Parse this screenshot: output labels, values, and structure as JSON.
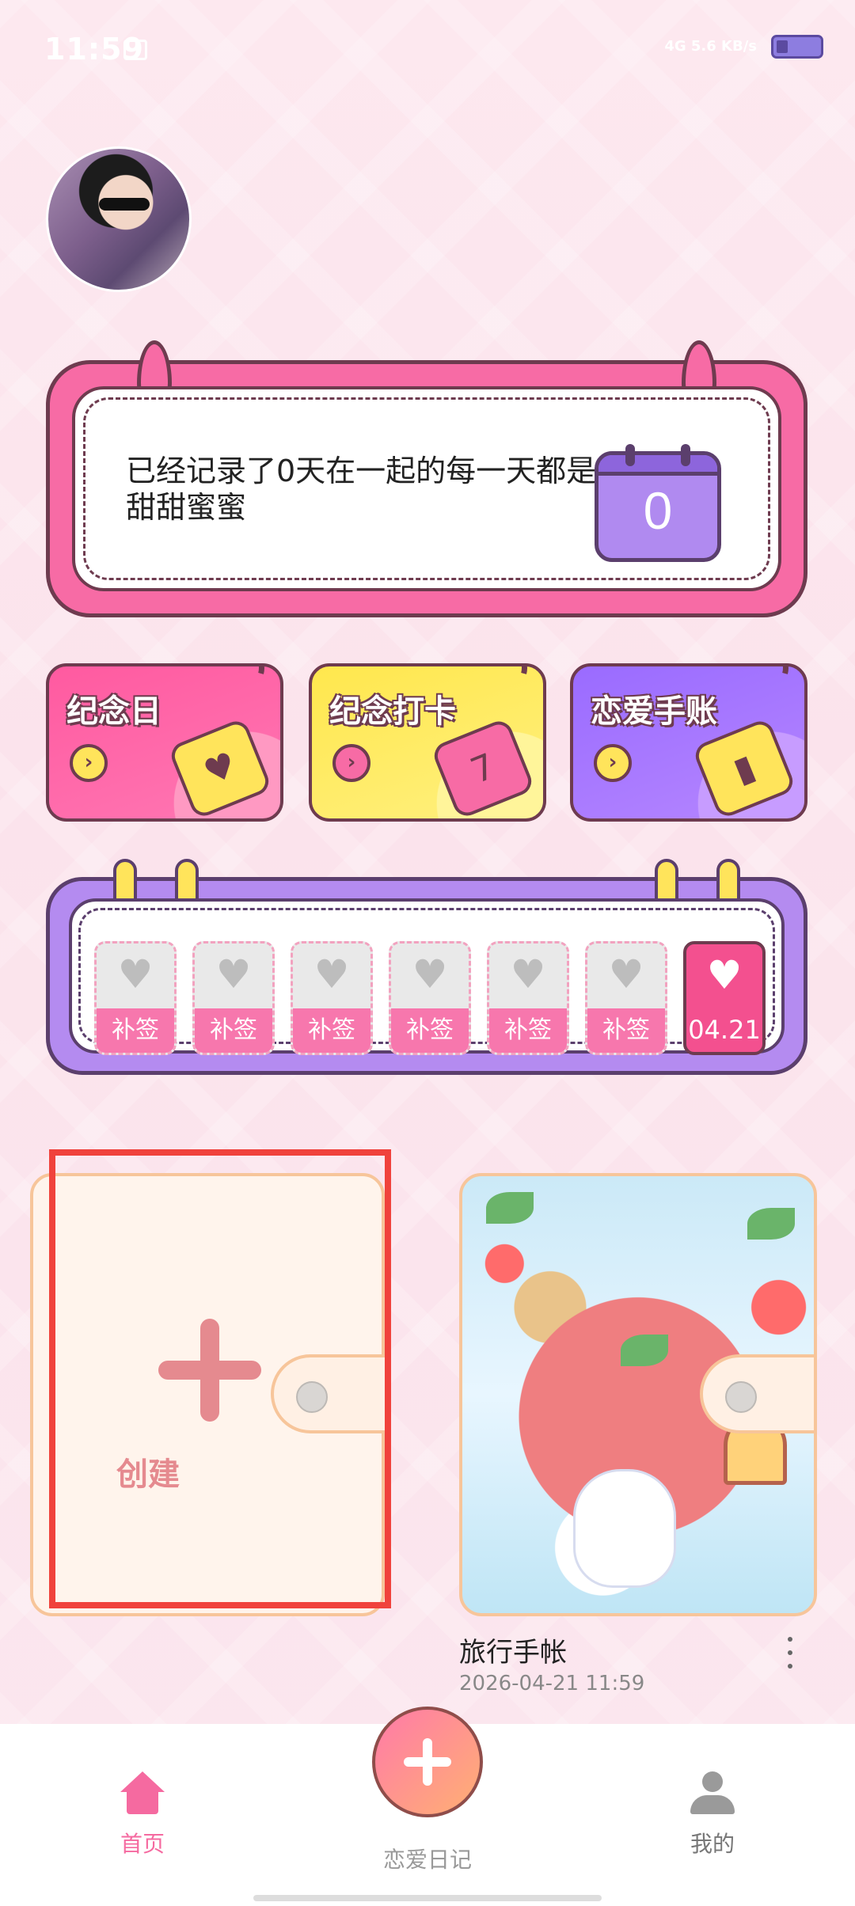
{
  "status_bar": {
    "time": "11:59",
    "network": "4G 5.6 KB/s",
    "sim_icon": "sim-icon",
    "battery_icon": "battery-icon"
  },
  "avatar": {
    "icon": "avatar-photo"
  },
  "counter": {
    "text": "已经记录了0天在一起的每一天都是甜甜蜜蜜",
    "days": "0",
    "icon": "calendar-icon"
  },
  "shortcuts": [
    {
      "label": "纪念日",
      "icon": "heart-calendar-icon",
      "glyph": "♥"
    },
    {
      "label": "纪念打卡",
      "icon": "calendar-7-icon",
      "glyph": "7"
    },
    {
      "label": "恋爱手账",
      "icon": "notebook-icon",
      "glyph": "▮"
    }
  ],
  "checkin": {
    "days": [
      {
        "label": "补签"
      },
      {
        "label": "补签"
      },
      {
        "label": "补签"
      },
      {
        "label": "补签"
      },
      {
        "label": "补签"
      },
      {
        "label": "补签"
      },
      {
        "label": "04.21"
      }
    ]
  },
  "notebooks": {
    "create_label": "创建",
    "items": [
      {
        "title": "旅行手帐",
        "date": "2026-04-21 11:59"
      }
    ]
  },
  "bottom_nav": {
    "home": "首页",
    "diary": "恋爱日记",
    "me": "我的"
  },
  "colors": {
    "accent": "#f56aa0",
    "highlight": "#f0423c",
    "purple": "#b48bf0",
    "yellow": "#ffe45b"
  }
}
